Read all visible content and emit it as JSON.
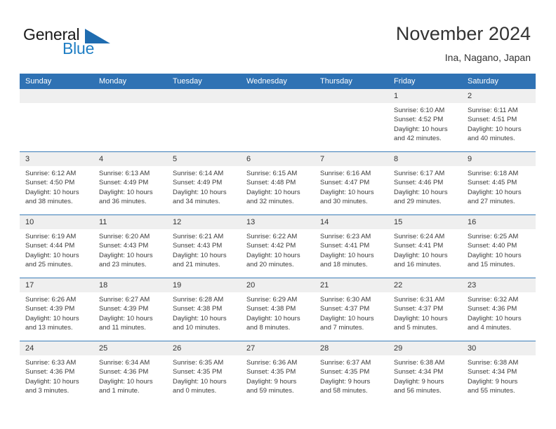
{
  "brand": {
    "name_part1": "General",
    "name_part2": "Blue",
    "logo_icon": "triangle-flag-icon",
    "accent_color": "#1f7ec4"
  },
  "header": {
    "title": "November 2024",
    "subtitle": "Ina, Nagano, Japan"
  },
  "theme": {
    "header_blue": "#2f72b4",
    "row_divider_blue": "#3a7cb8",
    "daynum_band": "#efefef",
    "text": "#3b3b3b"
  },
  "weekday_headers": [
    "Sunday",
    "Monday",
    "Tuesday",
    "Wednesday",
    "Thursday",
    "Friday",
    "Saturday"
  ],
  "weeks": [
    [
      {
        "day": "",
        "blank": true,
        "lines": []
      },
      {
        "day": "",
        "blank": true,
        "lines": []
      },
      {
        "day": "",
        "blank": true,
        "lines": []
      },
      {
        "day": "",
        "blank": true,
        "lines": []
      },
      {
        "day": "",
        "blank": true,
        "lines": []
      },
      {
        "day": "1",
        "blank": false,
        "lines": [
          "Sunrise: 6:10 AM",
          "Sunset: 4:52 PM",
          "Daylight: 10 hours",
          "and 42 minutes."
        ]
      },
      {
        "day": "2",
        "blank": false,
        "lines": [
          "Sunrise: 6:11 AM",
          "Sunset: 4:51 PM",
          "Daylight: 10 hours",
          "and 40 minutes."
        ]
      }
    ],
    [
      {
        "day": "3",
        "blank": false,
        "lines": [
          "Sunrise: 6:12 AM",
          "Sunset: 4:50 PM",
          "Daylight: 10 hours",
          "and 38 minutes."
        ]
      },
      {
        "day": "4",
        "blank": false,
        "lines": [
          "Sunrise: 6:13 AM",
          "Sunset: 4:49 PM",
          "Daylight: 10 hours",
          "and 36 minutes."
        ]
      },
      {
        "day": "5",
        "blank": false,
        "lines": [
          "Sunrise: 6:14 AM",
          "Sunset: 4:49 PM",
          "Daylight: 10 hours",
          "and 34 minutes."
        ]
      },
      {
        "day": "6",
        "blank": false,
        "lines": [
          "Sunrise: 6:15 AM",
          "Sunset: 4:48 PM",
          "Daylight: 10 hours",
          "and 32 minutes."
        ]
      },
      {
        "day": "7",
        "blank": false,
        "lines": [
          "Sunrise: 6:16 AM",
          "Sunset: 4:47 PM",
          "Daylight: 10 hours",
          "and 30 minutes."
        ]
      },
      {
        "day": "8",
        "blank": false,
        "lines": [
          "Sunrise: 6:17 AM",
          "Sunset: 4:46 PM",
          "Daylight: 10 hours",
          "and 29 minutes."
        ]
      },
      {
        "day": "9",
        "blank": false,
        "lines": [
          "Sunrise: 6:18 AM",
          "Sunset: 4:45 PM",
          "Daylight: 10 hours",
          "and 27 minutes."
        ]
      }
    ],
    [
      {
        "day": "10",
        "blank": false,
        "lines": [
          "Sunrise: 6:19 AM",
          "Sunset: 4:44 PM",
          "Daylight: 10 hours",
          "and 25 minutes."
        ]
      },
      {
        "day": "11",
        "blank": false,
        "lines": [
          "Sunrise: 6:20 AM",
          "Sunset: 4:43 PM",
          "Daylight: 10 hours",
          "and 23 minutes."
        ]
      },
      {
        "day": "12",
        "blank": false,
        "lines": [
          "Sunrise: 6:21 AM",
          "Sunset: 4:43 PM",
          "Daylight: 10 hours",
          "and 21 minutes."
        ]
      },
      {
        "day": "13",
        "blank": false,
        "lines": [
          "Sunrise: 6:22 AM",
          "Sunset: 4:42 PM",
          "Daylight: 10 hours",
          "and 20 minutes."
        ]
      },
      {
        "day": "14",
        "blank": false,
        "lines": [
          "Sunrise: 6:23 AM",
          "Sunset: 4:41 PM",
          "Daylight: 10 hours",
          "and 18 minutes."
        ]
      },
      {
        "day": "15",
        "blank": false,
        "lines": [
          "Sunrise: 6:24 AM",
          "Sunset: 4:41 PM",
          "Daylight: 10 hours",
          "and 16 minutes."
        ]
      },
      {
        "day": "16",
        "blank": false,
        "lines": [
          "Sunrise: 6:25 AM",
          "Sunset: 4:40 PM",
          "Daylight: 10 hours",
          "and 15 minutes."
        ]
      }
    ],
    [
      {
        "day": "17",
        "blank": false,
        "lines": [
          "Sunrise: 6:26 AM",
          "Sunset: 4:39 PM",
          "Daylight: 10 hours",
          "and 13 minutes."
        ]
      },
      {
        "day": "18",
        "blank": false,
        "lines": [
          "Sunrise: 6:27 AM",
          "Sunset: 4:39 PM",
          "Daylight: 10 hours",
          "and 11 minutes."
        ]
      },
      {
        "day": "19",
        "blank": false,
        "lines": [
          "Sunrise: 6:28 AM",
          "Sunset: 4:38 PM",
          "Daylight: 10 hours",
          "and 10 minutes."
        ]
      },
      {
        "day": "20",
        "blank": false,
        "lines": [
          "Sunrise: 6:29 AM",
          "Sunset: 4:38 PM",
          "Daylight: 10 hours",
          "and 8 minutes."
        ]
      },
      {
        "day": "21",
        "blank": false,
        "lines": [
          "Sunrise: 6:30 AM",
          "Sunset: 4:37 PM",
          "Daylight: 10 hours",
          "and 7 minutes."
        ]
      },
      {
        "day": "22",
        "blank": false,
        "lines": [
          "Sunrise: 6:31 AM",
          "Sunset: 4:37 PM",
          "Daylight: 10 hours",
          "and 5 minutes."
        ]
      },
      {
        "day": "23",
        "blank": false,
        "lines": [
          "Sunrise: 6:32 AM",
          "Sunset: 4:36 PM",
          "Daylight: 10 hours",
          "and 4 minutes."
        ]
      }
    ],
    [
      {
        "day": "24",
        "blank": false,
        "lines": [
          "Sunrise: 6:33 AM",
          "Sunset: 4:36 PM",
          "Daylight: 10 hours",
          "and 3 minutes."
        ]
      },
      {
        "day": "25",
        "blank": false,
        "lines": [
          "Sunrise: 6:34 AM",
          "Sunset: 4:36 PM",
          "Daylight: 10 hours",
          "and 1 minute."
        ]
      },
      {
        "day": "26",
        "blank": false,
        "lines": [
          "Sunrise: 6:35 AM",
          "Sunset: 4:35 PM",
          "Daylight: 10 hours",
          "and 0 minutes."
        ]
      },
      {
        "day": "27",
        "blank": false,
        "lines": [
          "Sunrise: 6:36 AM",
          "Sunset: 4:35 PM",
          "Daylight: 9 hours",
          "and 59 minutes."
        ]
      },
      {
        "day": "28",
        "blank": false,
        "lines": [
          "Sunrise: 6:37 AM",
          "Sunset: 4:35 PM",
          "Daylight: 9 hours",
          "and 58 minutes."
        ]
      },
      {
        "day": "29",
        "blank": false,
        "lines": [
          "Sunrise: 6:38 AM",
          "Sunset: 4:34 PM",
          "Daylight: 9 hours",
          "and 56 minutes."
        ]
      },
      {
        "day": "30",
        "blank": false,
        "lines": [
          "Sunrise: 6:38 AM",
          "Sunset: 4:34 PM",
          "Daylight: 9 hours",
          "and 55 minutes."
        ]
      }
    ]
  ]
}
